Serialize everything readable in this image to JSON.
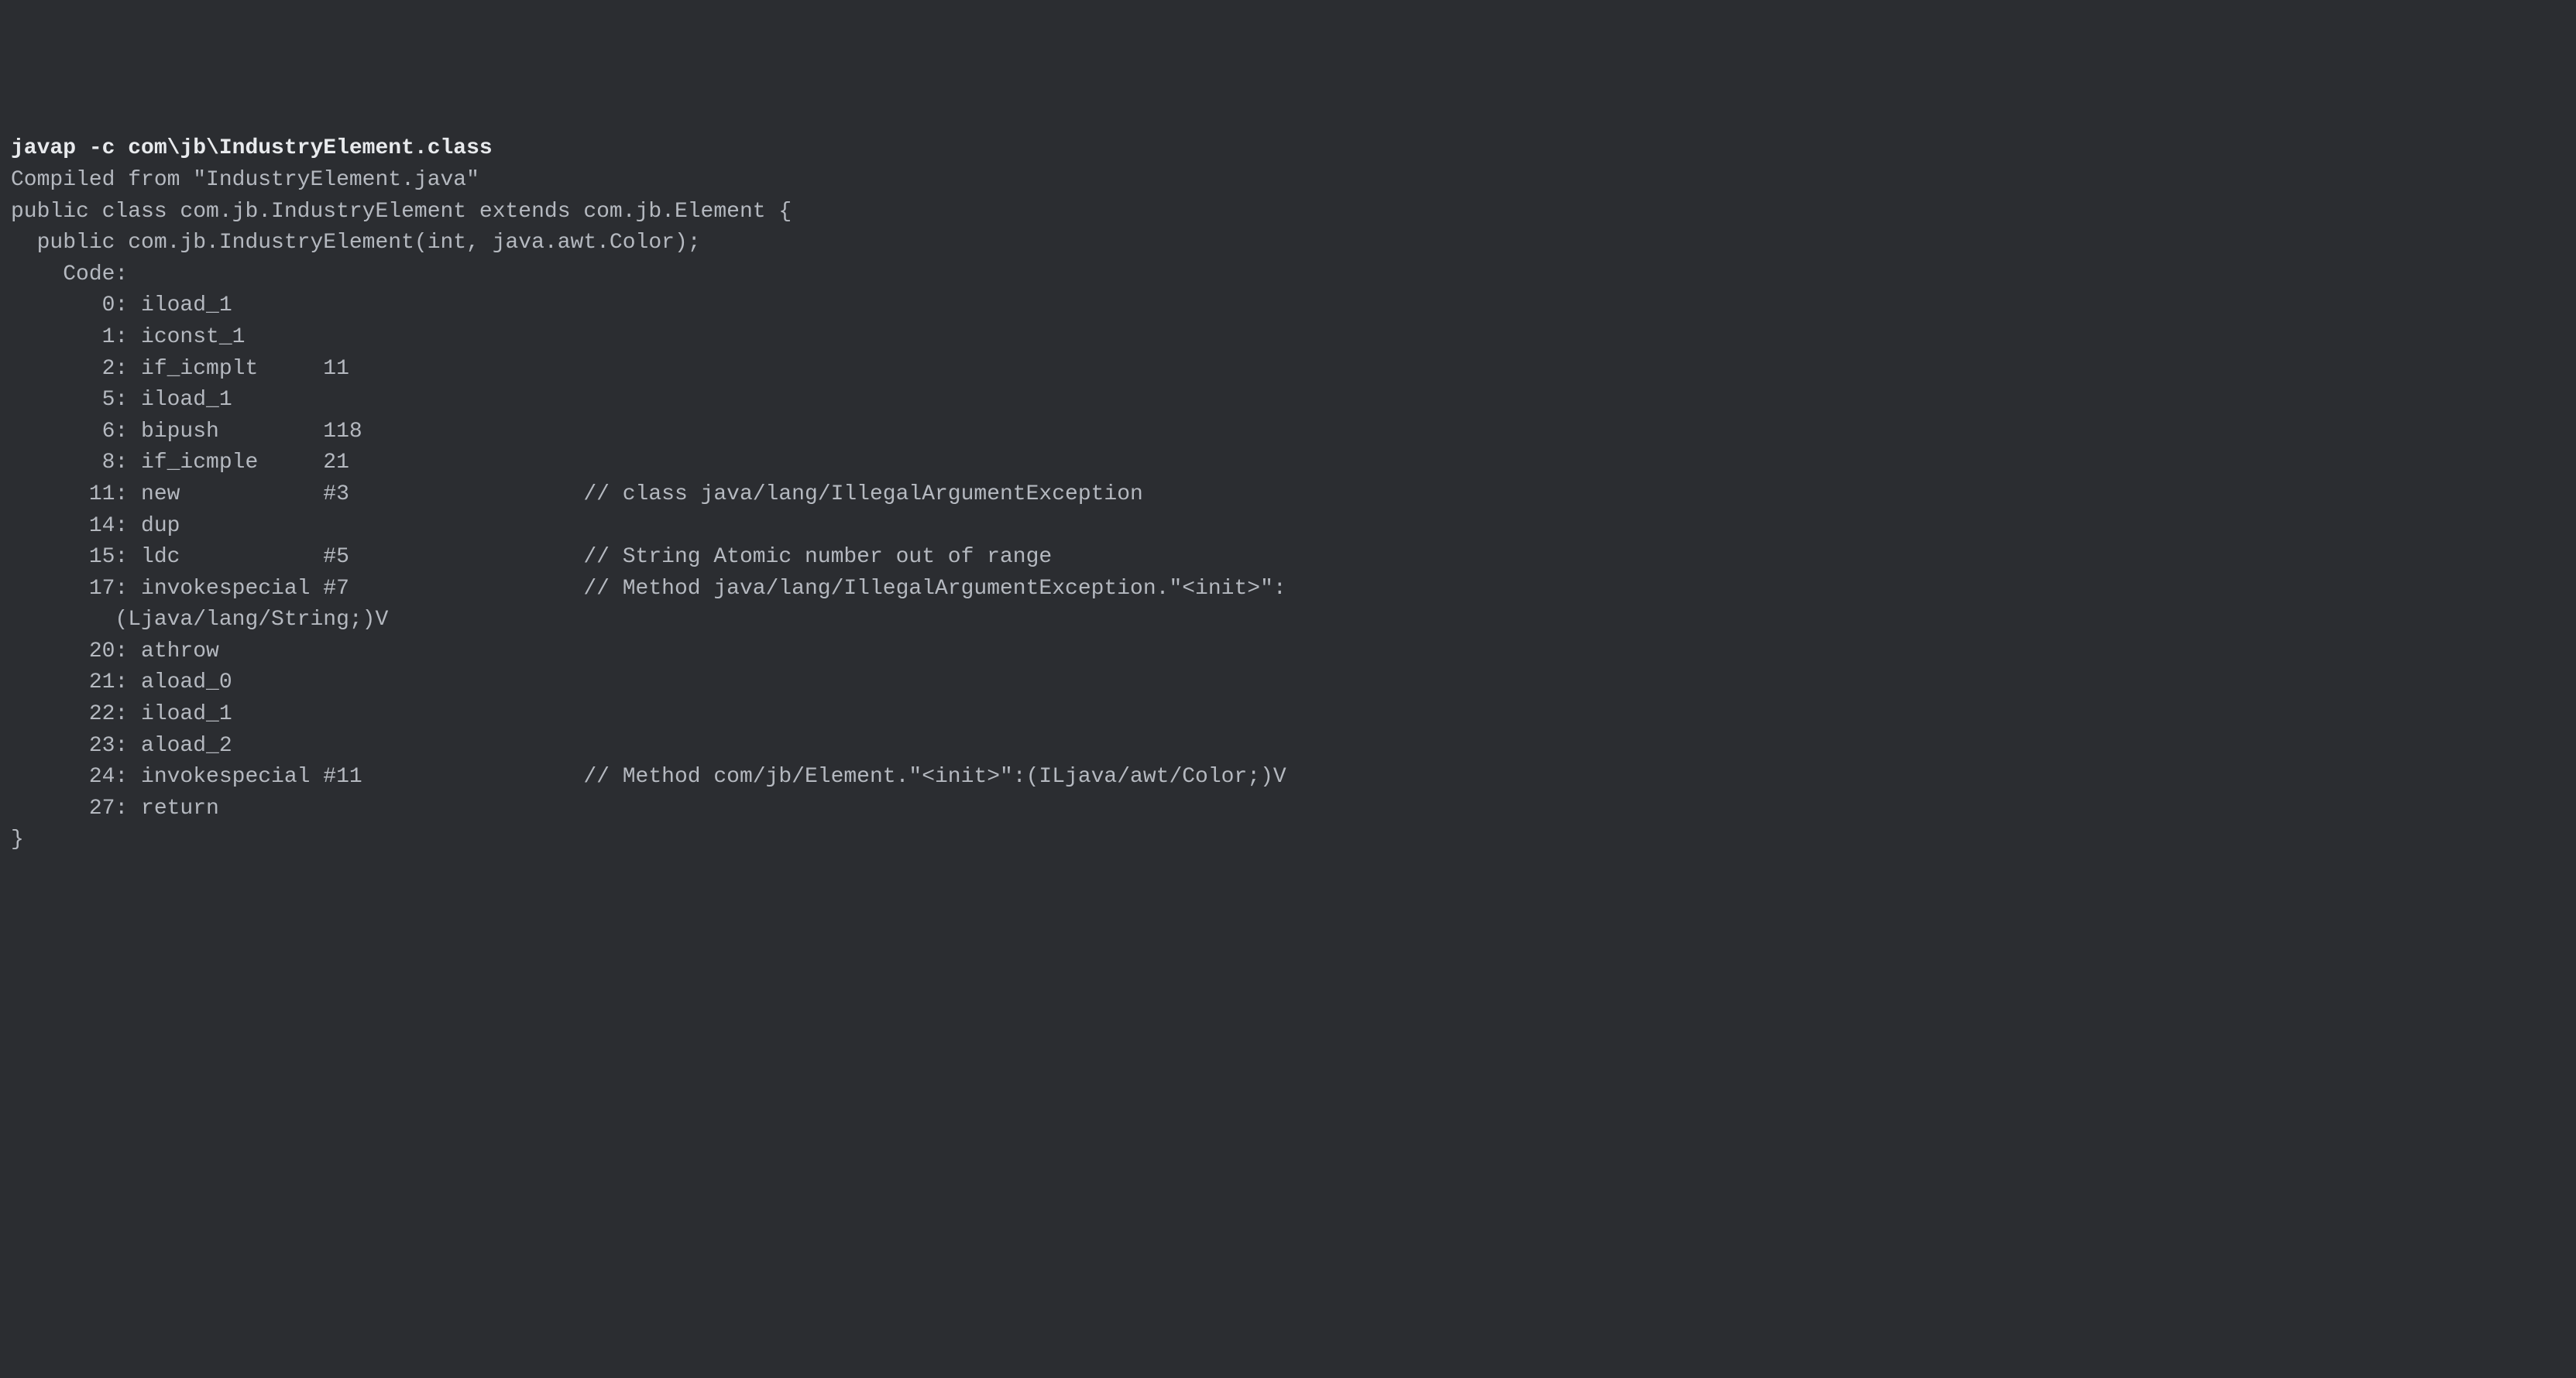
{
  "command": "javap -c com\\jb\\IndustryElement.class",
  "output_lines": [
    "Compiled from \"IndustryElement.java\"",
    "public class com.jb.IndustryElement extends com.jb.Element {",
    "  public com.jb.IndustryElement(int, java.awt.Color);",
    "    Code:",
    "       0: iload_1",
    "       1: iconst_1",
    "       2: if_icmplt     11",
    "       5: iload_1",
    "       6: bipush        118",
    "       8: if_icmple     21",
    "      11: new           #3                  // class java/lang/IllegalArgumentException",
    "      14: dup",
    "      15: ldc           #5                  // String Atomic number out of range",
    "      17: invokespecial #7                  // Method java/lang/IllegalArgumentException.\"<init>\":",
    "        (Ljava/lang/String;)V",
    "      20: athrow",
    "      21: aload_0",
    "      22: iload_1",
    "      23: aload_2",
    "      24: invokespecial #11                 // Method com/jb/Element.\"<init>\":(ILjava/awt/Color;)V",
    "      27: return",
    "}"
  ]
}
